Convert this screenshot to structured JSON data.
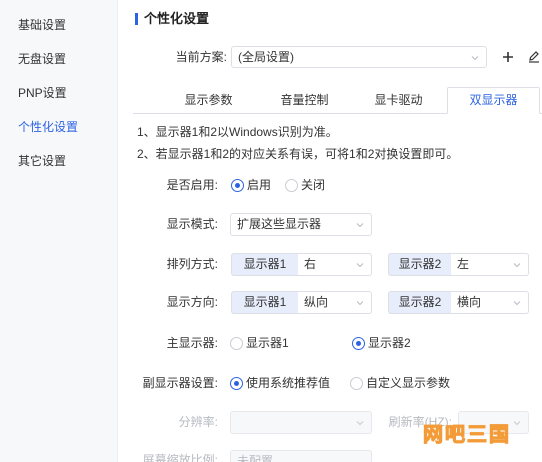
{
  "sidebar": {
    "items": [
      {
        "label": "基础设置"
      },
      {
        "label": "无盘设置"
      },
      {
        "label": "PNP设置"
      },
      {
        "label": "个性化设置"
      },
      {
        "label": "其它设置"
      }
    ],
    "active_index": 3
  },
  "header": {
    "title": "个性化设置"
  },
  "scheme": {
    "label": "当前方案:",
    "value": "(全局设置)",
    "add_icon": "plus-icon",
    "edit_icon": "pencil-icon"
  },
  "tabs": [
    {
      "label": "显示参数",
      "active": false
    },
    {
      "label": "音量控制",
      "active": false
    },
    {
      "label": "显卡驱动",
      "active": false
    },
    {
      "label": "双显示器",
      "active": true
    }
  ],
  "notes": [
    "1、显示器1和2以Windows识别为准。",
    "2、若显示器1和2的对应关系有误，可将1和2对换设置即可。"
  ],
  "form": {
    "enable": {
      "label": "是否启用:",
      "options": [
        "启用",
        "关闭"
      ],
      "selected": "启用"
    },
    "mode": {
      "label": "显示模式:",
      "value": "扩展这些显示器"
    },
    "arrange": {
      "label": "排列方式:",
      "monitor1": "显示器1",
      "monitor1_value": "右",
      "monitor2": "显示器2",
      "monitor2_value": "左"
    },
    "orientation": {
      "label": "显示方向:",
      "monitor1": "显示器1",
      "monitor1_value": "纵向",
      "monitor2": "显示器2",
      "monitor2_value": "横向"
    },
    "primary": {
      "label": "主显示器:",
      "options": [
        "显示器1",
        "显示器2"
      ],
      "selected": "显示器2"
    },
    "secondary": {
      "label": "副显示器设置:",
      "options": [
        "使用系统推荐值",
        "自定义显示参数"
      ],
      "selected": "使用系统推荐值"
    },
    "resolution": {
      "label": "分辨率:",
      "value": "",
      "disabled": true
    },
    "refresh": {
      "label": "刷新率(HZ):",
      "value": "",
      "disabled": true
    },
    "scale": {
      "label": "屏幕缩放比例:",
      "value": "未配置",
      "disabled": true
    }
  },
  "watermark": "网吧三国",
  "colors": {
    "accent": "#2d63e3",
    "tag_bg": "#e8edfb",
    "watermark": "#f29b38"
  }
}
